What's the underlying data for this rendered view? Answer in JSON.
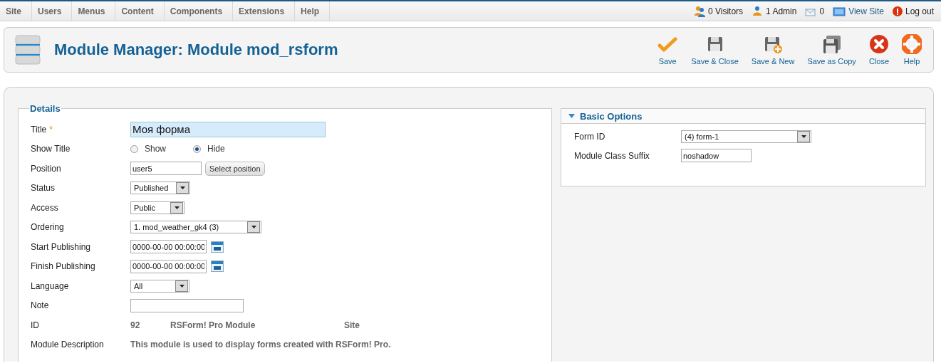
{
  "menu": [
    {
      "label": "Site"
    },
    {
      "label": "Users"
    },
    {
      "label": "Menus"
    },
    {
      "label": "Content"
    },
    {
      "label": "Components"
    },
    {
      "label": "Extensions"
    },
    {
      "label": "Help"
    }
  ],
  "status": [
    {
      "kind": "visitors",
      "label": "0 Visitors"
    },
    {
      "kind": "admin",
      "label": "1 Admin"
    },
    {
      "kind": "messages",
      "label": "0"
    },
    {
      "kind": "view_site",
      "label": "View Site"
    },
    {
      "kind": "logout",
      "label": "Log out"
    }
  ],
  "header": {
    "title": "Module Manager: Module mod_rsform"
  },
  "toolbar": [
    {
      "kind": "save",
      "label": "Save"
    },
    {
      "kind": "save_close",
      "label": "Save & Close"
    },
    {
      "kind": "save_new",
      "label": "Save & New"
    },
    {
      "kind": "save_copy",
      "label": "Save as Copy"
    },
    {
      "kind": "close",
      "label": "Close"
    },
    {
      "kind": "help",
      "label": "Help"
    }
  ],
  "details": {
    "legend": "Details",
    "fields": [
      {
        "kind": "text",
        "label": "Title",
        "required_mark": "*",
        "value": "Моя форма"
      },
      {
        "kind": "radio",
        "label": "Show Title",
        "options": [
          {
            "label": "Show",
            "selected": false
          },
          {
            "label": "Hide",
            "selected": true
          }
        ]
      },
      {
        "kind": "text_button",
        "label": "Position",
        "value": "user5",
        "button": "Select position"
      },
      {
        "kind": "select",
        "label": "Status",
        "value": "Published"
      },
      {
        "kind": "select",
        "label": "Access",
        "value": "Public"
      },
      {
        "kind": "select",
        "label": "Ordering",
        "value": "1. mod_weather_gk4 (3)"
      },
      {
        "kind": "date",
        "label": "Start Publishing",
        "value": "0000-00-00 00:00:00"
      },
      {
        "kind": "date",
        "label": "Finish Publishing",
        "value": "0000-00-00 00:00:00"
      },
      {
        "kind": "select",
        "label": "Language",
        "value": "All"
      },
      {
        "kind": "text",
        "label": "Note"
      },
      {
        "kind": "info",
        "label": "ID",
        "parts": [
          "92",
          "RSForm! Pro Module",
          "Site"
        ]
      },
      {
        "kind": "description",
        "label": "Module Description",
        "value": "This module is used to display forms created with RSForm! Pro."
      }
    ]
  },
  "basic_options": {
    "title": "Basic Options",
    "expanded": true,
    "fields": [
      {
        "kind": "select",
        "label": "Form ID",
        "value": "(4) form-1"
      },
      {
        "kind": "text",
        "label": "Module Class Suffix",
        "value": "noshadow"
      }
    ]
  }
}
